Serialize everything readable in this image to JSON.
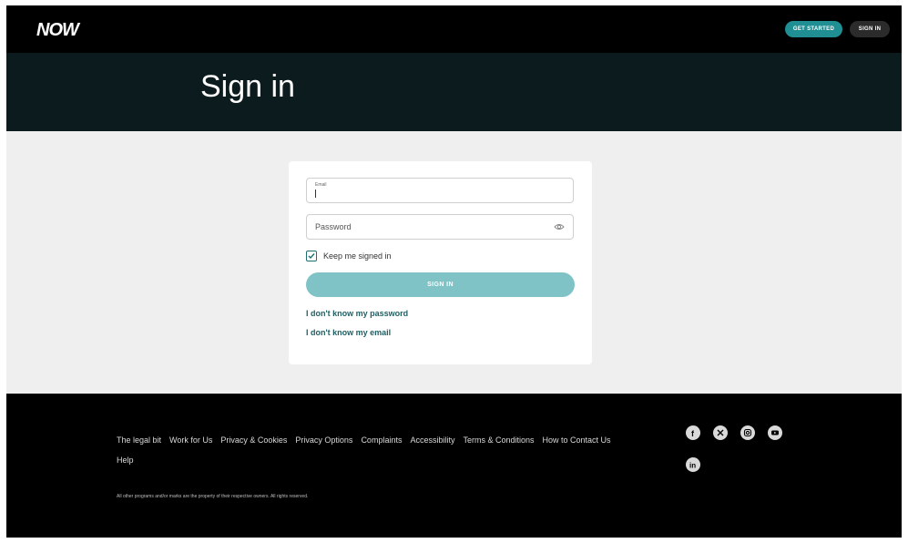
{
  "header": {
    "logo_text": "NOW",
    "get_started_label": "GET STARTED",
    "sign_in_label": "SIGN IN"
  },
  "hero": {
    "title": "Sign in"
  },
  "form": {
    "email_label": "Email",
    "email_value": "",
    "password_placeholder": "Password",
    "keep_signed_in_label": "Keep me signed in",
    "keep_signed_in_checked": true,
    "sign_in_label": "SIGN IN",
    "forgot_password_link": "I don't know my password",
    "forgot_email_link": "I don't know my email"
  },
  "footer": {
    "links": [
      "The legal bit",
      "Work for Us",
      "Privacy & Cookies",
      "Privacy Options",
      "Complaints",
      "Accessibility",
      "Terms & Conditions",
      "How to Contact Us",
      "Help"
    ],
    "social_icons": [
      "facebook-icon",
      "x-icon",
      "instagram-icon",
      "youtube-icon",
      "linkedin-icon"
    ],
    "copyright": "All other programs and/or marks are the property of their respective owners. All rights reserved."
  },
  "colors": {
    "brand_teal": "#1f8f93",
    "button_light_teal": "#7fc3c7",
    "hero_bg": "#0c1b1d",
    "link_color": "#1f5f63"
  }
}
